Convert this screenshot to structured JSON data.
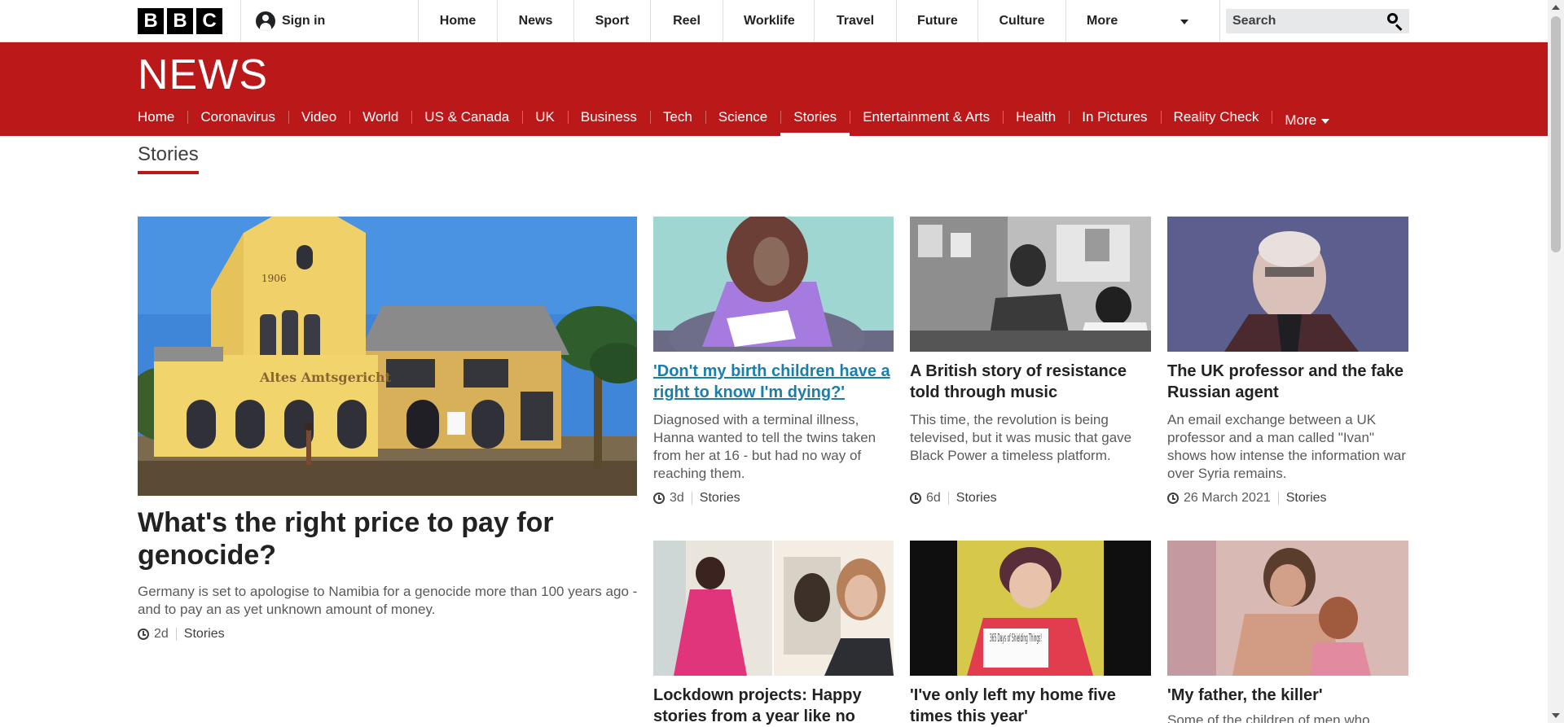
{
  "global_bar": {
    "logo_letters": [
      "B",
      "B",
      "C"
    ],
    "signin_label": "Sign in",
    "nav": [
      "Home",
      "News",
      "Sport",
      "Reel",
      "Worklife",
      "Travel",
      "Future",
      "Culture"
    ],
    "more_label": "More",
    "search_placeholder": "Search"
  },
  "news_header": {
    "logo_text": "NEWS",
    "nav": [
      {
        "label": "Home",
        "active": false
      },
      {
        "label": "Coronavirus",
        "active": false
      },
      {
        "label": "Video",
        "active": false
      },
      {
        "label": "World",
        "active": false
      },
      {
        "label": "US & Canada",
        "active": false
      },
      {
        "label": "UK",
        "active": false
      },
      {
        "label": "Business",
        "active": false
      },
      {
        "label": "Tech",
        "active": false
      },
      {
        "label": "Science",
        "active": false
      },
      {
        "label": "Stories",
        "active": true
      },
      {
        "label": "Entertainment & Arts",
        "active": false
      },
      {
        "label": "Health",
        "active": false
      },
      {
        "label": "In Pictures",
        "active": false
      },
      {
        "label": "Reality Check",
        "active": false
      }
    ],
    "more_label": "More"
  },
  "section_title": "Stories",
  "stories": {
    "featured": {
      "headline": "What's the right price to pay for genocide?",
      "summary": "Germany is set to apologise to Namibia for a genocide more than 100 years ago - and to pay an as yet unknown amount of money.",
      "time": "2d",
      "tag": "Stories",
      "image_sign": "Altes Amtsgericht",
      "image_year": "1906"
    },
    "items": [
      {
        "headline": "'Don't my birth children have a right to know I'm dying?'",
        "summary": "Diagnosed with a terminal illness, Hanna wanted to tell the twins taken from her at 16 - but had no way of reaching them.",
        "time": "3d",
        "tag": "Stories"
      },
      {
        "headline": "A British story of resistance told through music",
        "summary": "This time, the revolution is being televised, but it was music that gave Black Power a timeless platform.",
        "time": "6d",
        "tag": "Stories"
      },
      {
        "headline": "The UK professor and the fake Russian agent",
        "summary": "An email exchange between a UK professor and a man called \"Ivan\" shows how intense the information war over Syria remains.",
        "time": "26 March 2021",
        "tag": "Stories"
      },
      {
        "headline": "Lockdown projects: Happy stories from a year like no"
      },
      {
        "headline": "'I've only left my home five times this year'",
        "image_sign": "365 Days of Shielding Things!"
      },
      {
        "headline": "'My father, the killer'",
        "summary": "Some of the children of men who"
      }
    ]
  },
  "colors": {
    "news_red": "#bb1919",
    "link_blue": "#1a7fa8",
    "text_dark": "#222222",
    "text_grey": "#5a5a5a"
  },
  "icons": [
    "user-icon",
    "search-icon",
    "chevron-down-icon",
    "clock-icon"
  ]
}
